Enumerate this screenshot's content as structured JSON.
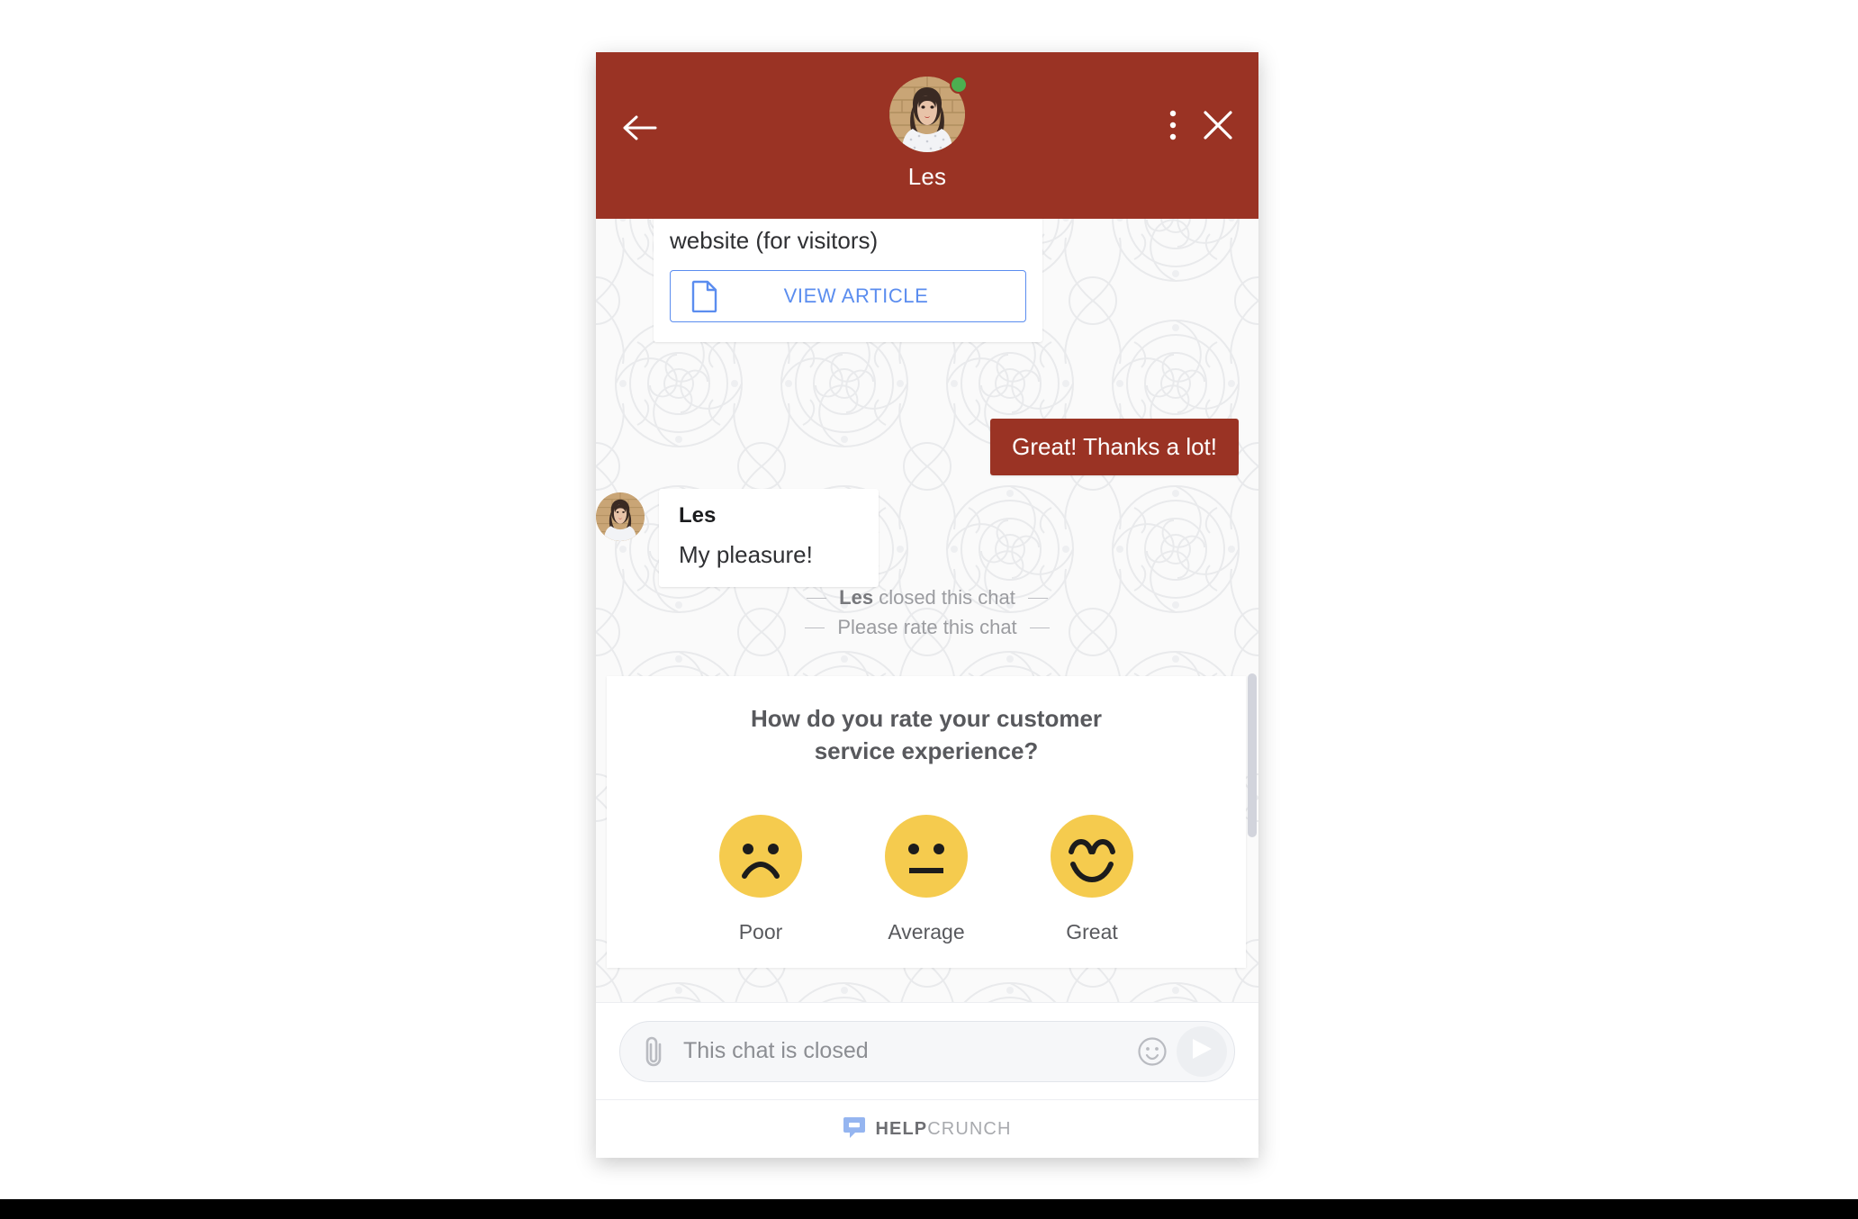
{
  "header": {
    "agent_name": "Les",
    "presence": "online",
    "back_icon": "arrow-left-icon",
    "menu_icon": "more-vertical-icon",
    "close_icon": "close-icon",
    "background_color": "#9a3324"
  },
  "messages": {
    "article_message": {
      "text": "website (for visitors)",
      "button_label": "VIEW ARTICLE",
      "button_icon": "document-icon",
      "button_color": "#5b8def"
    },
    "outgoing": {
      "text": "Great! Thanks a lot!",
      "bubble_color": "#9a3324"
    },
    "incoming": {
      "sender": "Les",
      "text": "My pleasure!"
    }
  },
  "system_events": [
    {
      "actor": "Les",
      "text": "closed this chat"
    },
    {
      "actor": "",
      "text": "Please rate this chat"
    }
  ],
  "rating_card": {
    "question": "How do you rate your customer service experience?",
    "options": [
      {
        "label": "Poor",
        "face": "sad-face-icon",
        "color": "#f5cb4e"
      },
      {
        "label": "Average",
        "face": "neutral-face-icon",
        "color": "#f5cb4e"
      },
      {
        "label": "Great",
        "face": "happy-face-icon",
        "color": "#f5cb4e"
      }
    ]
  },
  "composer": {
    "placeholder": "This chat is closed",
    "value": "",
    "attach_icon": "paperclip-icon",
    "emoji_icon": "smiley-icon",
    "send_icon": "send-icon"
  },
  "footer": {
    "brand_bold": "HELP",
    "brand_light": "CRUNCH",
    "logo_icon": "helpcrunch-chat-logo-icon",
    "logo_color": "#95b5f0"
  }
}
